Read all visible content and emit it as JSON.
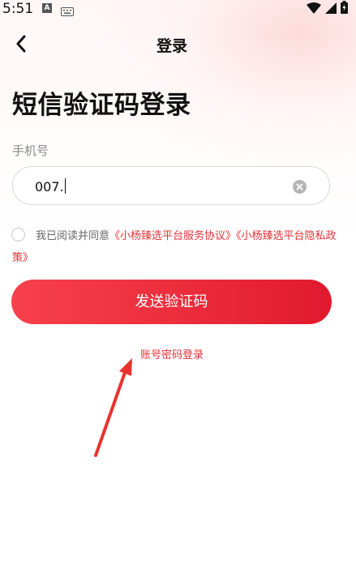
{
  "status_bar": {
    "time": "5:51",
    "notification_icon": "A"
  },
  "header": {
    "back_icon": "chevron-left-icon",
    "title": "登录"
  },
  "main": {
    "heading": "短信验证码登录",
    "phone_label": "手机号",
    "phone_value": "007.",
    "agreement": {
      "prefix": "我已阅读并同意",
      "link_service": "《小杨臻选平台服务协议》",
      "link_privacy": "《小杨臻选平台隐私政策》",
      "checked": false
    },
    "send_code_label": "发送验证码",
    "password_login_label": "账号密码登录"
  },
  "colors": {
    "accent": "#e53238",
    "button_gradient_start": "#f7414c",
    "button_gradient_end": "#e01a2e"
  }
}
